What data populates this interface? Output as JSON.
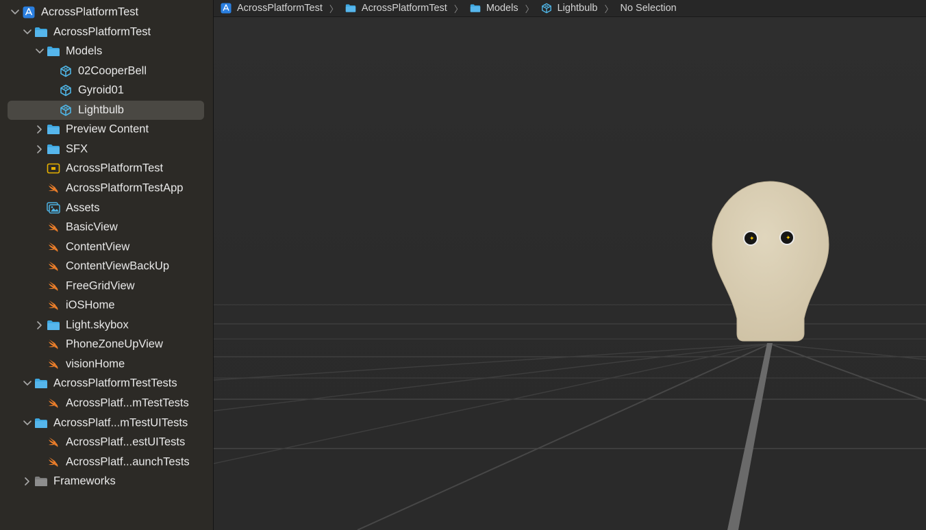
{
  "navigator": {
    "items": [
      {
        "label": "AcrossPlatformTest",
        "icon": "xcode-project-icon",
        "disclosure": "open"
      },
      {
        "label": "AcrossPlatformTest",
        "icon": "folder-icon",
        "disclosure": "open"
      },
      {
        "label": "Models",
        "icon": "folder-icon",
        "disclosure": "open"
      },
      {
        "label": "02CooperBell",
        "icon": "3d-model-icon",
        "disclosure": "none"
      },
      {
        "label": "Gyroid01",
        "icon": "3d-model-icon",
        "disclosure": "none"
      },
      {
        "label": "Lightbulb",
        "icon": "3d-model-icon",
        "disclosure": "none",
        "selected": true
      },
      {
        "label": "Preview Content",
        "icon": "folder-icon",
        "disclosure": "closed"
      },
      {
        "label": "SFX",
        "icon": "folder-icon",
        "disclosure": "closed"
      },
      {
        "label": "AcrossPlatformTest",
        "icon": "entitlements-icon",
        "disclosure": "none"
      },
      {
        "label": "AcrossPlatformTestApp",
        "icon": "swift-file-icon",
        "disclosure": "none"
      },
      {
        "label": "Assets",
        "icon": "asset-catalog-icon",
        "disclosure": "none"
      },
      {
        "label": "BasicView",
        "icon": "swift-file-icon",
        "disclosure": "none"
      },
      {
        "label": "ContentView",
        "icon": "swift-file-icon",
        "disclosure": "none"
      },
      {
        "label": "ContentViewBackUp",
        "icon": "swift-file-icon",
        "disclosure": "none"
      },
      {
        "label": "FreeGridView",
        "icon": "swift-file-icon",
        "disclosure": "none"
      },
      {
        "label": "iOSHome",
        "icon": "swift-file-icon",
        "disclosure": "none"
      },
      {
        "label": "Light.skybox",
        "icon": "folder-icon",
        "disclosure": "closed"
      },
      {
        "label": "PhoneZoneUpView",
        "icon": "swift-file-icon",
        "disclosure": "none"
      },
      {
        "label": "visionHome",
        "icon": "swift-file-icon",
        "disclosure": "none"
      },
      {
        "label": "AcrossPlatformTestTests",
        "icon": "folder-icon",
        "disclosure": "open"
      },
      {
        "label": "AcrossPlatf...mTestTests",
        "icon": "swift-file-icon",
        "disclosure": "none"
      },
      {
        "label": "AcrossPlatf...mTestUITests",
        "icon": "folder-icon",
        "disclosure": "open"
      },
      {
        "label": "AcrossPlatf...estUITests",
        "icon": "swift-file-icon",
        "disclosure": "none"
      },
      {
        "label": "AcrossPlatf...aunchTests",
        "icon": "swift-file-icon",
        "disclosure": "none"
      },
      {
        "label": "Frameworks",
        "icon": "gray-folder-icon",
        "disclosure": "closed"
      }
    ]
  },
  "jumpbar": {
    "crumbs": [
      {
        "label": "AcrossPlatformTest",
        "icon": "xcode-project-icon"
      },
      {
        "label": "AcrossPlatformTest",
        "icon": "folder-icon"
      },
      {
        "label": "Models",
        "icon": "folder-icon"
      },
      {
        "label": "Lightbulb",
        "icon": "3d-model-icon"
      },
      {
        "label": "No Selection",
        "icon": ""
      }
    ],
    "separator": "〉"
  },
  "viewport": {
    "model_name": "Lightbulb",
    "model_color": "#d7cbb0"
  },
  "colors": {
    "folder": "#3ea7e0",
    "swift": "#f0802a",
    "model": "#4fb3e3",
    "entitlements": "#e8b200",
    "selection": "#4a4843"
  }
}
